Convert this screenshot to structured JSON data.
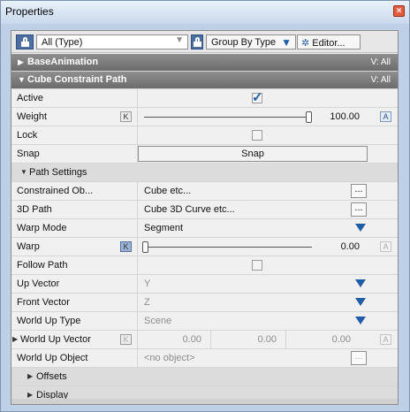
{
  "window": {
    "title": "Properties",
    "close_icon": "close-icon"
  },
  "toolbar": {
    "type_filter": "All (Type)",
    "group_by": "Group By Type",
    "editor": "Editor...",
    "icons": [
      "lock-icon",
      "chevron-down-icon",
      "gear-icon"
    ]
  },
  "sections": {
    "base_animation": {
      "label": "BaseAnimation",
      "visibility": "V: All"
    },
    "cube_constraint": {
      "label": "Cube Constraint Path",
      "visibility": "V: All"
    }
  },
  "rows": {
    "active": {
      "label": "Active",
      "checked": true
    },
    "weight": {
      "label": "Weight",
      "key": "K",
      "value": "100.00",
      "anim": "A",
      "slider_fraction": 1.0
    },
    "lock": {
      "label": "Lock",
      "checked": false
    },
    "snap": {
      "label": "Snap",
      "button": "Snap"
    },
    "path_settings": {
      "label": "Path Settings"
    },
    "constrained": {
      "label": "Constrained Ob...",
      "value": "Cube etc...",
      "button": "..."
    },
    "path3d": {
      "label": "3D Path",
      "value": "Cube 3D Curve etc...",
      "button": "..."
    },
    "warp_mode": {
      "label": "Warp Mode",
      "value": "Segment"
    },
    "warp": {
      "label": "Warp",
      "key": "K",
      "value": "0.00",
      "anim": "A",
      "slider_fraction": 0.0
    },
    "follow_path": {
      "label": "Follow Path",
      "checked": false
    },
    "up_vector": {
      "label": "Up Vector",
      "value": "Y"
    },
    "front_vector": {
      "label": "Front Vector",
      "value": "Z"
    },
    "world_up_type": {
      "label": "World Up Type",
      "value": "Scene"
    },
    "world_up_vector": {
      "label": "World Up Vector",
      "key": "K",
      "x": "0.00",
      "y": "0.00",
      "z": "0.00",
      "anim": "A"
    },
    "world_up_object": {
      "label": "World Up Object",
      "value": "<no object>",
      "button": "..."
    },
    "offsets": {
      "label": "Offsets"
    },
    "display": {
      "label": "Display"
    }
  },
  "colors": {
    "accent": "#1f5da8",
    "section_header": "#7a7a7a",
    "panel_bg": "#f0f0f0"
  }
}
